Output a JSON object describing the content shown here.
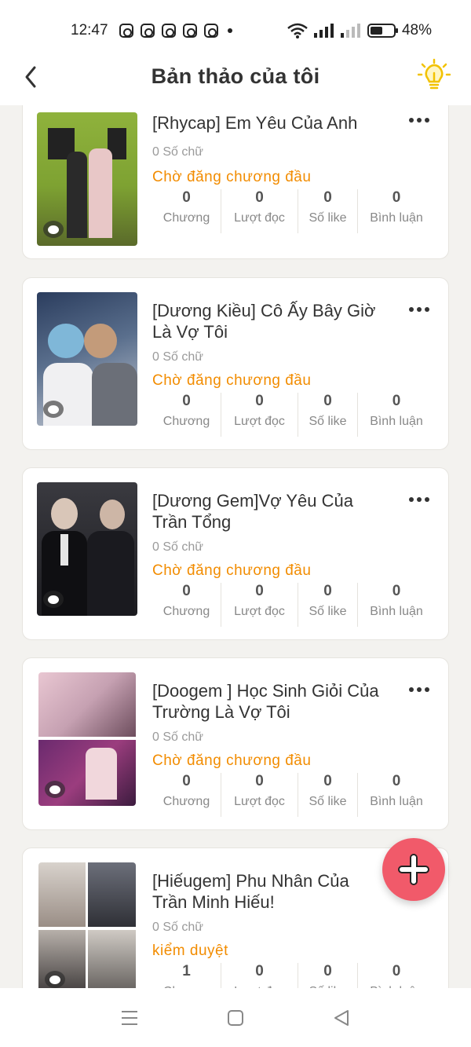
{
  "status_bar": {
    "time": "12:47",
    "battery": "48%"
  },
  "header": {
    "title": "Bản thảo của tôi"
  },
  "stat_labels": [
    "Chương",
    "Lượt đọc",
    "Số like",
    "Bình luận"
  ],
  "works": [
    {
      "title": "[Rhycap] Em Yêu Của Anh",
      "word_count": "0 Số chữ",
      "status": "Chờ đăng chương đầu",
      "stats": [
        "0",
        "0",
        "0",
        "0"
      ]
    },
    {
      "title": "[Dương Kiều] Cô Ấy Bây Giờ Là Vợ Tôi",
      "word_count": "0 Số chữ",
      "status": "Chờ đăng chương đầu",
      "stats": [
        "0",
        "0",
        "0",
        "0"
      ]
    },
    {
      "title": "[Dương Gem]Vợ Yêu Của Trần Tổng",
      "word_count": "0 Số chữ",
      "status": "Chờ đăng chương đầu",
      "stats": [
        "0",
        "0",
        "0",
        "0"
      ]
    },
    {
      "title": "[Doogem ] Học Sinh Giỏi Của Trường Là Vợ Tôi",
      "word_count": "0 Số chữ",
      "status": "Chờ đăng chương đầu",
      "stats": [
        "0",
        "0",
        "0",
        "0"
      ]
    },
    {
      "title": "[Hiếugem] Phu Nhân Của Trần Minh Hiếu!",
      "word_count": "0 Số chữ",
      "status": "kiểm duyệt",
      "stats": [
        "1",
        "0",
        "0",
        "0"
      ]
    }
  ],
  "colors": {
    "accent_orange": "#f28c00",
    "fab": "#f15a6a",
    "bulb": "#f2c200"
  },
  "icons": [
    "back-arrow-icon",
    "lightbulb-icon",
    "more-icon",
    "comment-bubble-icon",
    "plus-icon",
    "menu-icon",
    "home-square-icon",
    "back-triangle-icon"
  ]
}
